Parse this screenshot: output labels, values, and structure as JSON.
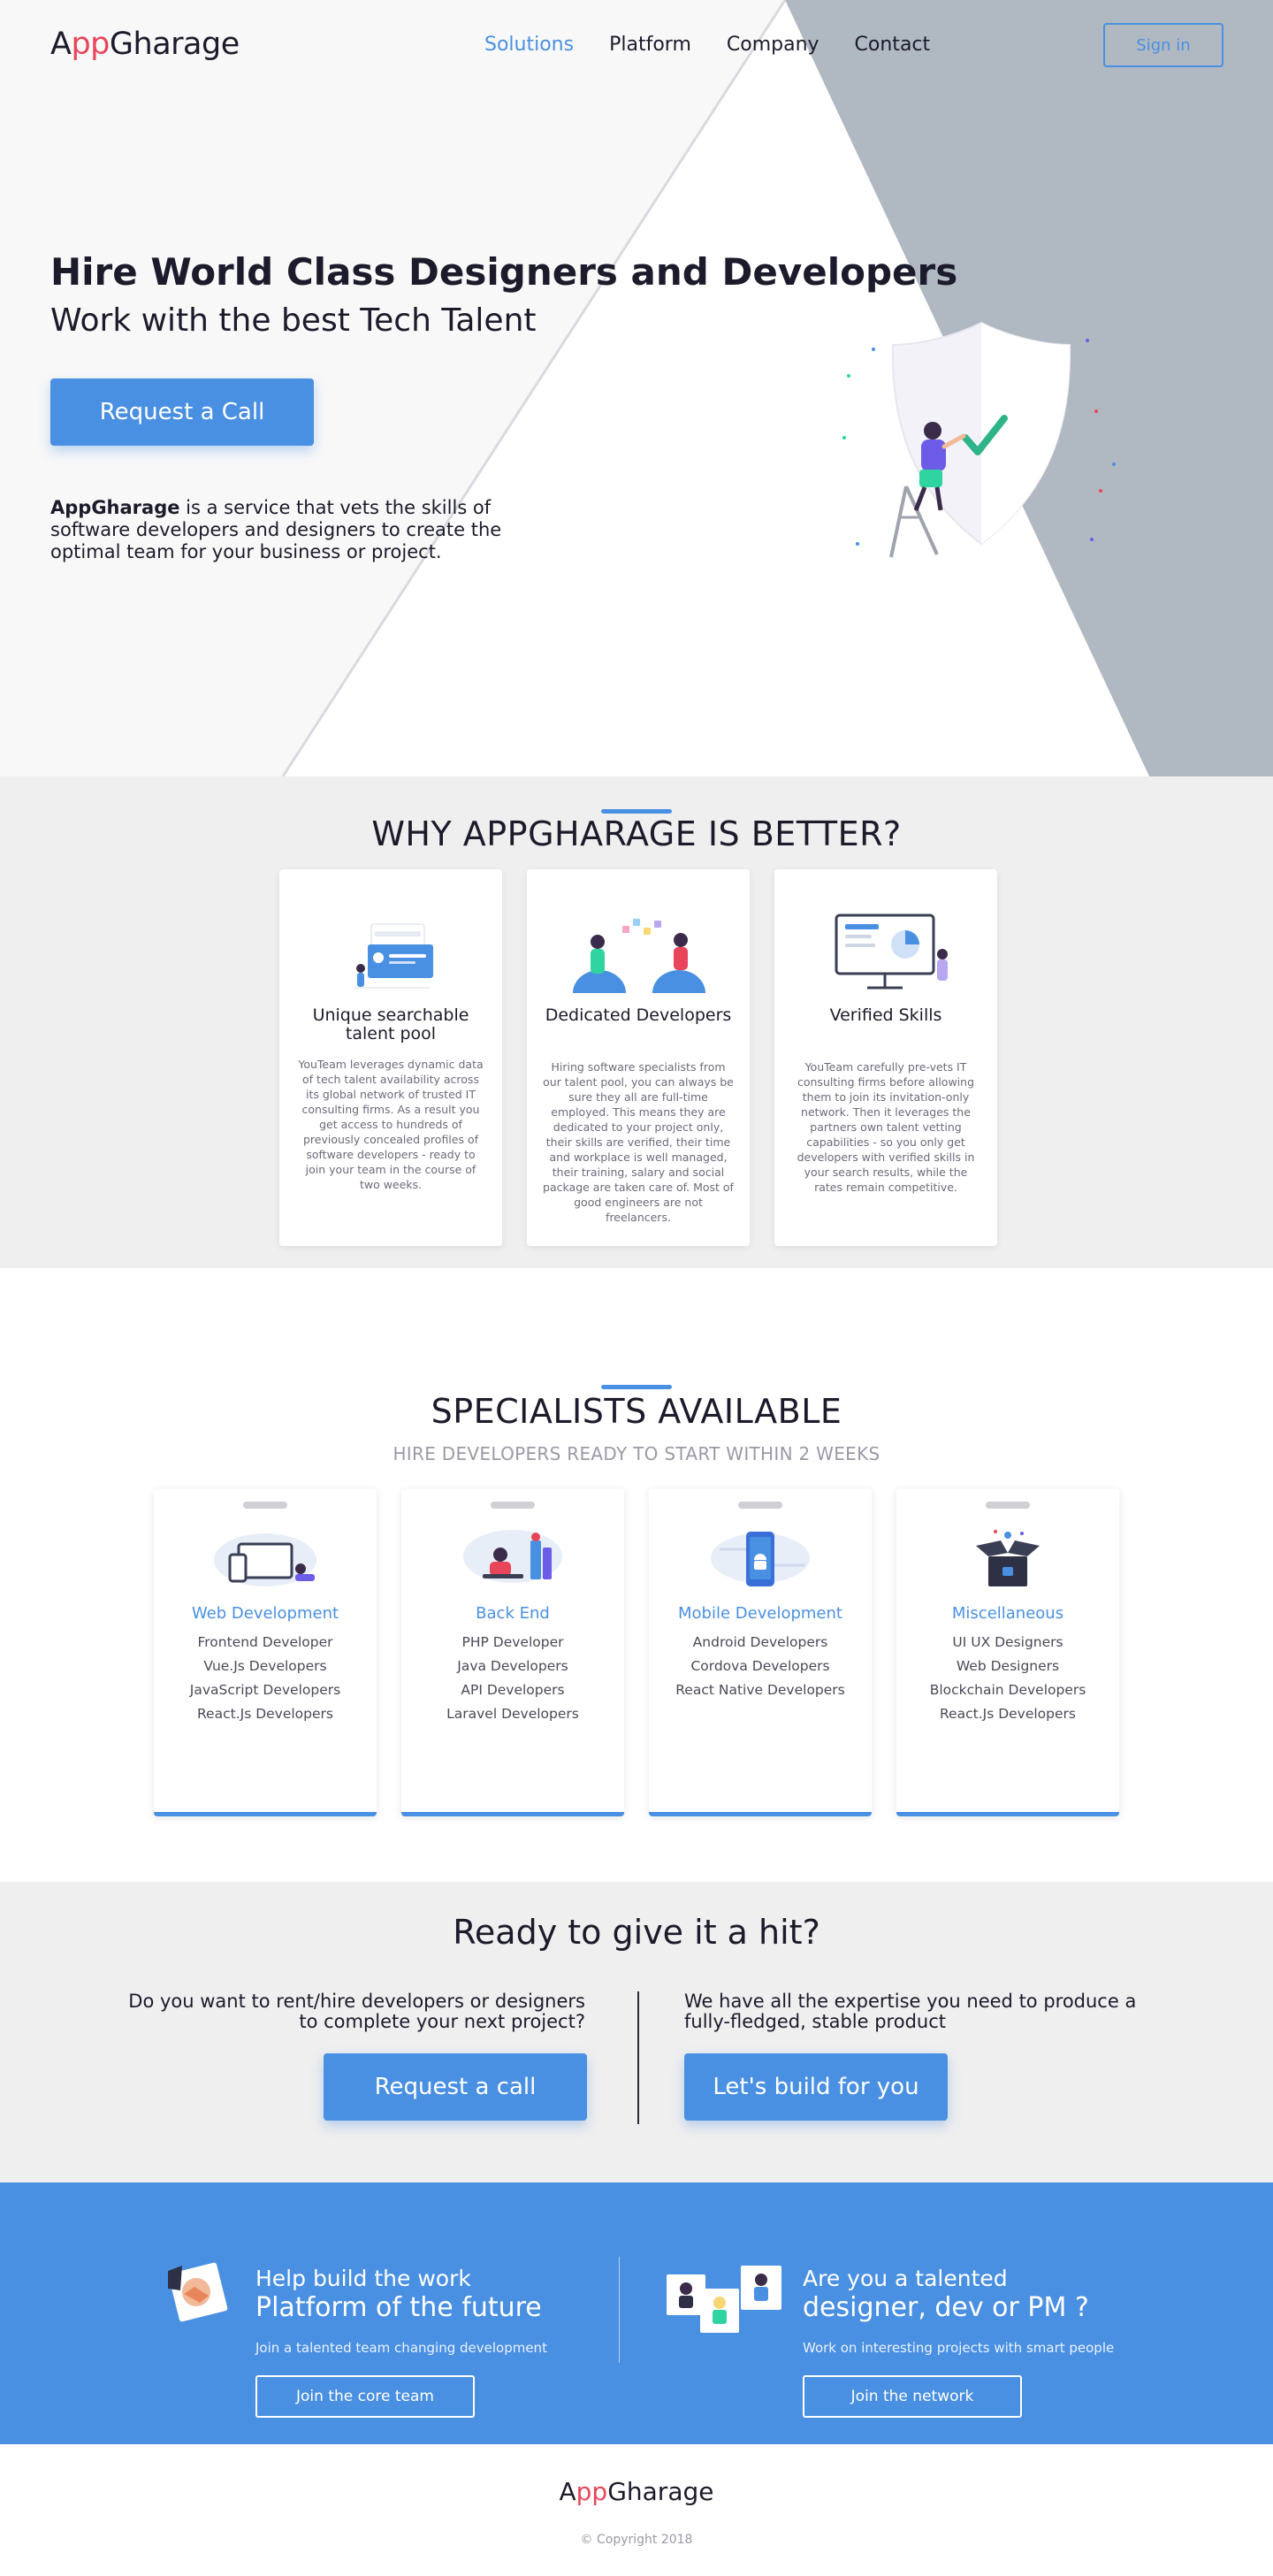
{
  "brand": {
    "name_prefix": "A",
    "name_pp": "pp",
    "name_rest": "Gharage",
    "accent": "#4a90e2",
    "logo_red": "#e8455a"
  },
  "nav": {
    "items": [
      "Solutions",
      "Platform",
      "Company",
      "Contact"
    ],
    "active": "Solutions",
    "sign_in": "Sign in"
  },
  "hero": {
    "title": "Hire World Class Designers and Developers",
    "subtitle": "Work with the best Tech Talent",
    "cta": "Request a Call",
    "desc_bold": "AppGharage",
    "desc_rest": " is a service that vets the skills of software developers and designers to create the optimal team for your business or project."
  },
  "why": {
    "title": "WHY APPGHARAGE IS BETTER?",
    "features": [
      {
        "title": "Unique searchable talent pool",
        "desc": "YouTeam leverages dynamic data of tech talent availability across its global network of trusted IT consulting firms. As a result you get access to hundreds of previously concealed profiles of software developers - ready to join your team in the course of two weeks.",
        "icon": "search-profile-icon"
      },
      {
        "title": "Dedicated Developers",
        "desc": "Hiring software specialists from our talent pool, you can always be sure they all are full-time employed. This means they are dedicated to your project only, their skills are verified, their time and workplace is well managed, their training, salary and social package are taken care of. Most of good engineers are not freelancers.",
        "icon": "team-chat-icon"
      },
      {
        "title": "Verified Skills",
        "desc": "YouTeam carefully pre-vets IT consulting firms before allowing them to join its invitation-only network. Then it leverages the partners own talent vetting capabilities - so you only get developers with verified skills in your search results, while the rates remain competitive.",
        "icon": "presentation-icon"
      }
    ]
  },
  "specialists": {
    "title": "SPECIALISTS AVAILABLE",
    "subtitle": "HIRE DEVELOPERS READY TO START WITHIN 2 WEEKS",
    "cards": [
      {
        "title": "Web Development",
        "items": [
          "Frontend Developer",
          "Vue.Js Developers",
          "JavaScript Developers",
          "React.Js Developers"
        ],
        "icon": "devices-icon"
      },
      {
        "title": "Back End",
        "items": [
          "PHP Developer",
          "Java Developers",
          "API Developers",
          "Laravel Developers"
        ],
        "icon": "server-developer-icon"
      },
      {
        "title": "Mobile Development",
        "items": [
          "Android Developers",
          "Cordova Developers",
          "React Native Developers"
        ],
        "icon": "mobile-android-icon"
      },
      {
        "title": "Miscellaneous",
        "items": [
          "UI UX Designers",
          "Web Designers",
          "Blockchain Developers",
          "React.Js Developers"
        ],
        "icon": "open-box-icon"
      }
    ]
  },
  "ready": {
    "title": "Ready to give it a hit?",
    "left_text": "Do you want to rent/hire developers or designers to complete your next project?",
    "left_button": "Request a call",
    "right_text": "We have all the expertise you need to produce a fully-fledged, stable product",
    "right_button": "Let's build for you"
  },
  "join": {
    "left": {
      "small": "Help build the work",
      "big": "Platform of the future",
      "desc": "Join a talented team changing development",
      "button": "Join the core team",
      "icon": "handshake-icon"
    },
    "right": {
      "small": "Are you a talented",
      "big": "designer, dev or PM ?",
      "desc": "Work on interesting projects with smart people",
      "button": "Join the network",
      "icon": "profile-cards-icon"
    }
  },
  "footer": {
    "copyright": "© Copyright 2018"
  }
}
